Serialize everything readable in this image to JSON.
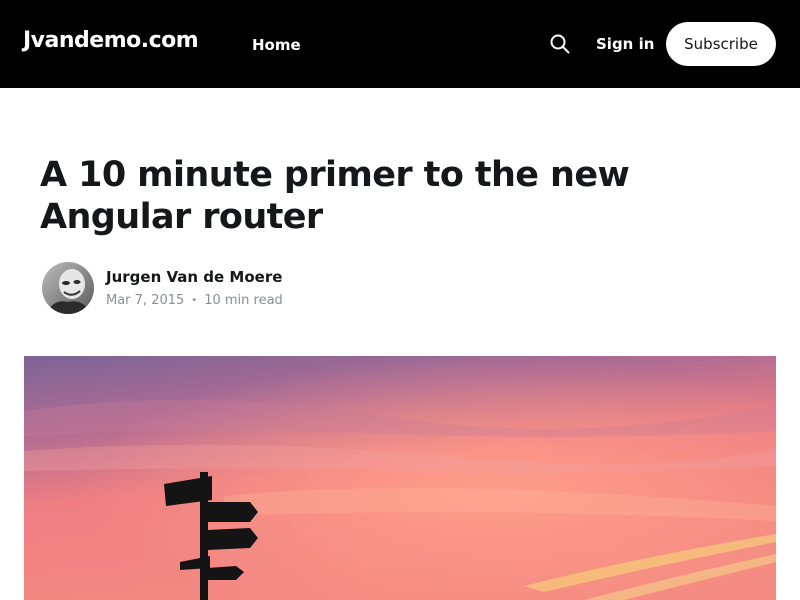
{
  "header": {
    "brand": "Jvandemo.com",
    "nav_home": "Home",
    "signin": "Sign in",
    "subscribe": "Subscribe",
    "search_icon": "search-icon",
    "background": "#000000"
  },
  "article": {
    "title": "A 10 minute primer to the new Angular router",
    "author": "Jurgen Van de Moere",
    "date": "Mar 7, 2015",
    "separator": "•",
    "read_time": "10 min read"
  },
  "colors": {
    "text": "#15171a",
    "meta": "#8a8f96",
    "sky_top": "#7c6497",
    "sky_mid": "#ee7e82",
    "sky_glow": "#ffa08a"
  }
}
